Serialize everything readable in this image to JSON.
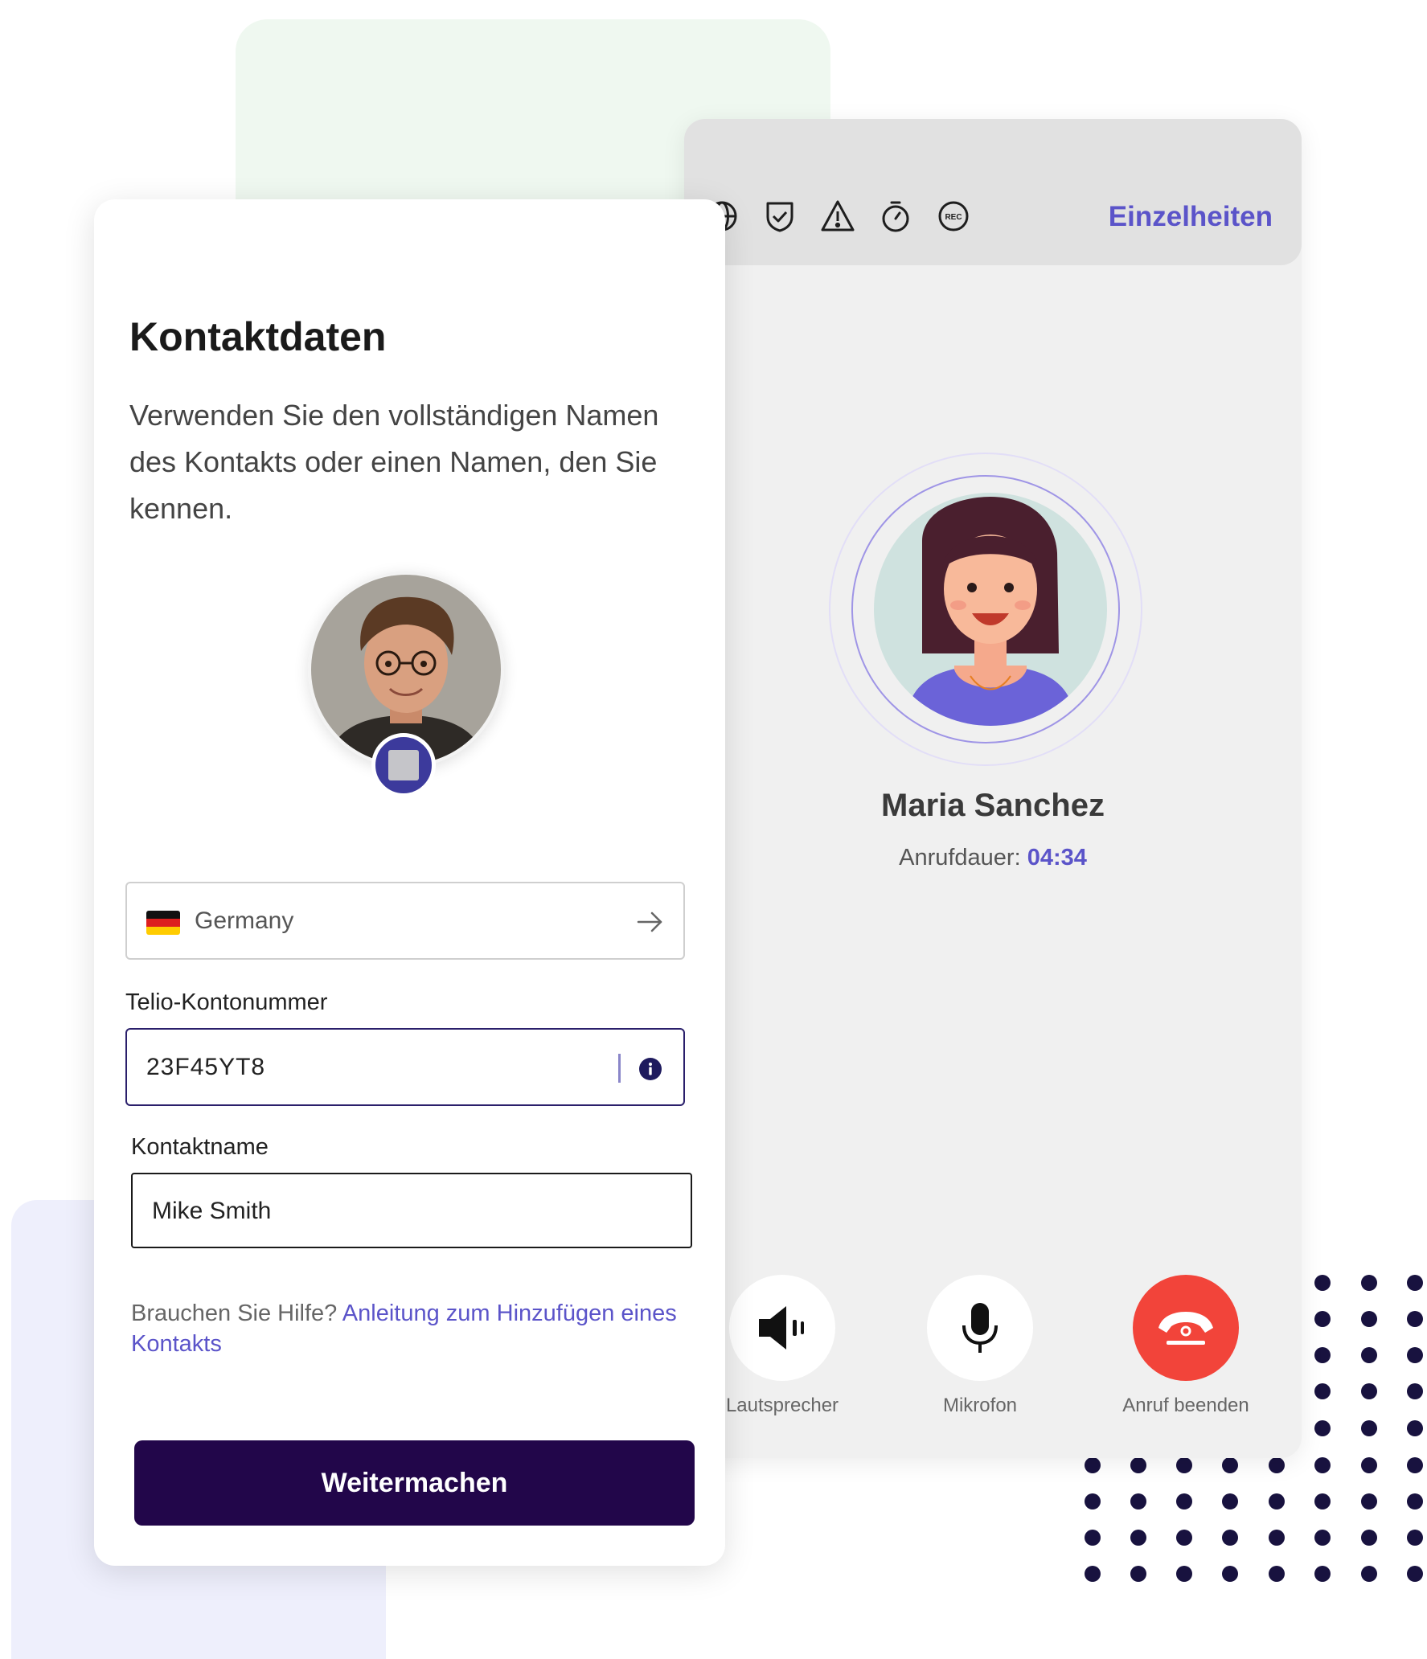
{
  "contact_form": {
    "title": "Kontaktdaten",
    "description": "Verwenden Sie den vollständigen Namen des Kontakts oder einen Namen, den Sie kennen.",
    "country": {
      "value": "Germany",
      "flag": "germany-flag"
    },
    "account_number": {
      "label": "Telio-Kontonummer",
      "value": "23F45YT8"
    },
    "contact_name": {
      "label": "Kontaktname",
      "value": "Mike Smith"
    },
    "help": {
      "text": "Brauchen Sie Hilfe?",
      "link": "Anleitung zum Hinzufügen eines Kontakts"
    },
    "continue_label": "Weitermachen"
  },
  "call": {
    "header_icons": [
      "globe-icon",
      "shield-check-icon",
      "warning-icon",
      "timer-icon",
      "rec-icon"
    ],
    "rec_text": "REC",
    "details_label": "Einzelheiten",
    "caller_name": "Maria Sanchez",
    "duration_label": "Anrufdauer:",
    "duration_value": "04:34",
    "controls": {
      "speaker": "Lautsprecher",
      "mic": "Mikrofon",
      "end": "Anruf beenden"
    }
  },
  "colors": {
    "accent": "#5b54c9",
    "primary_button": "#22064a",
    "end_call": "#f2443a",
    "dots": "#18123f"
  }
}
